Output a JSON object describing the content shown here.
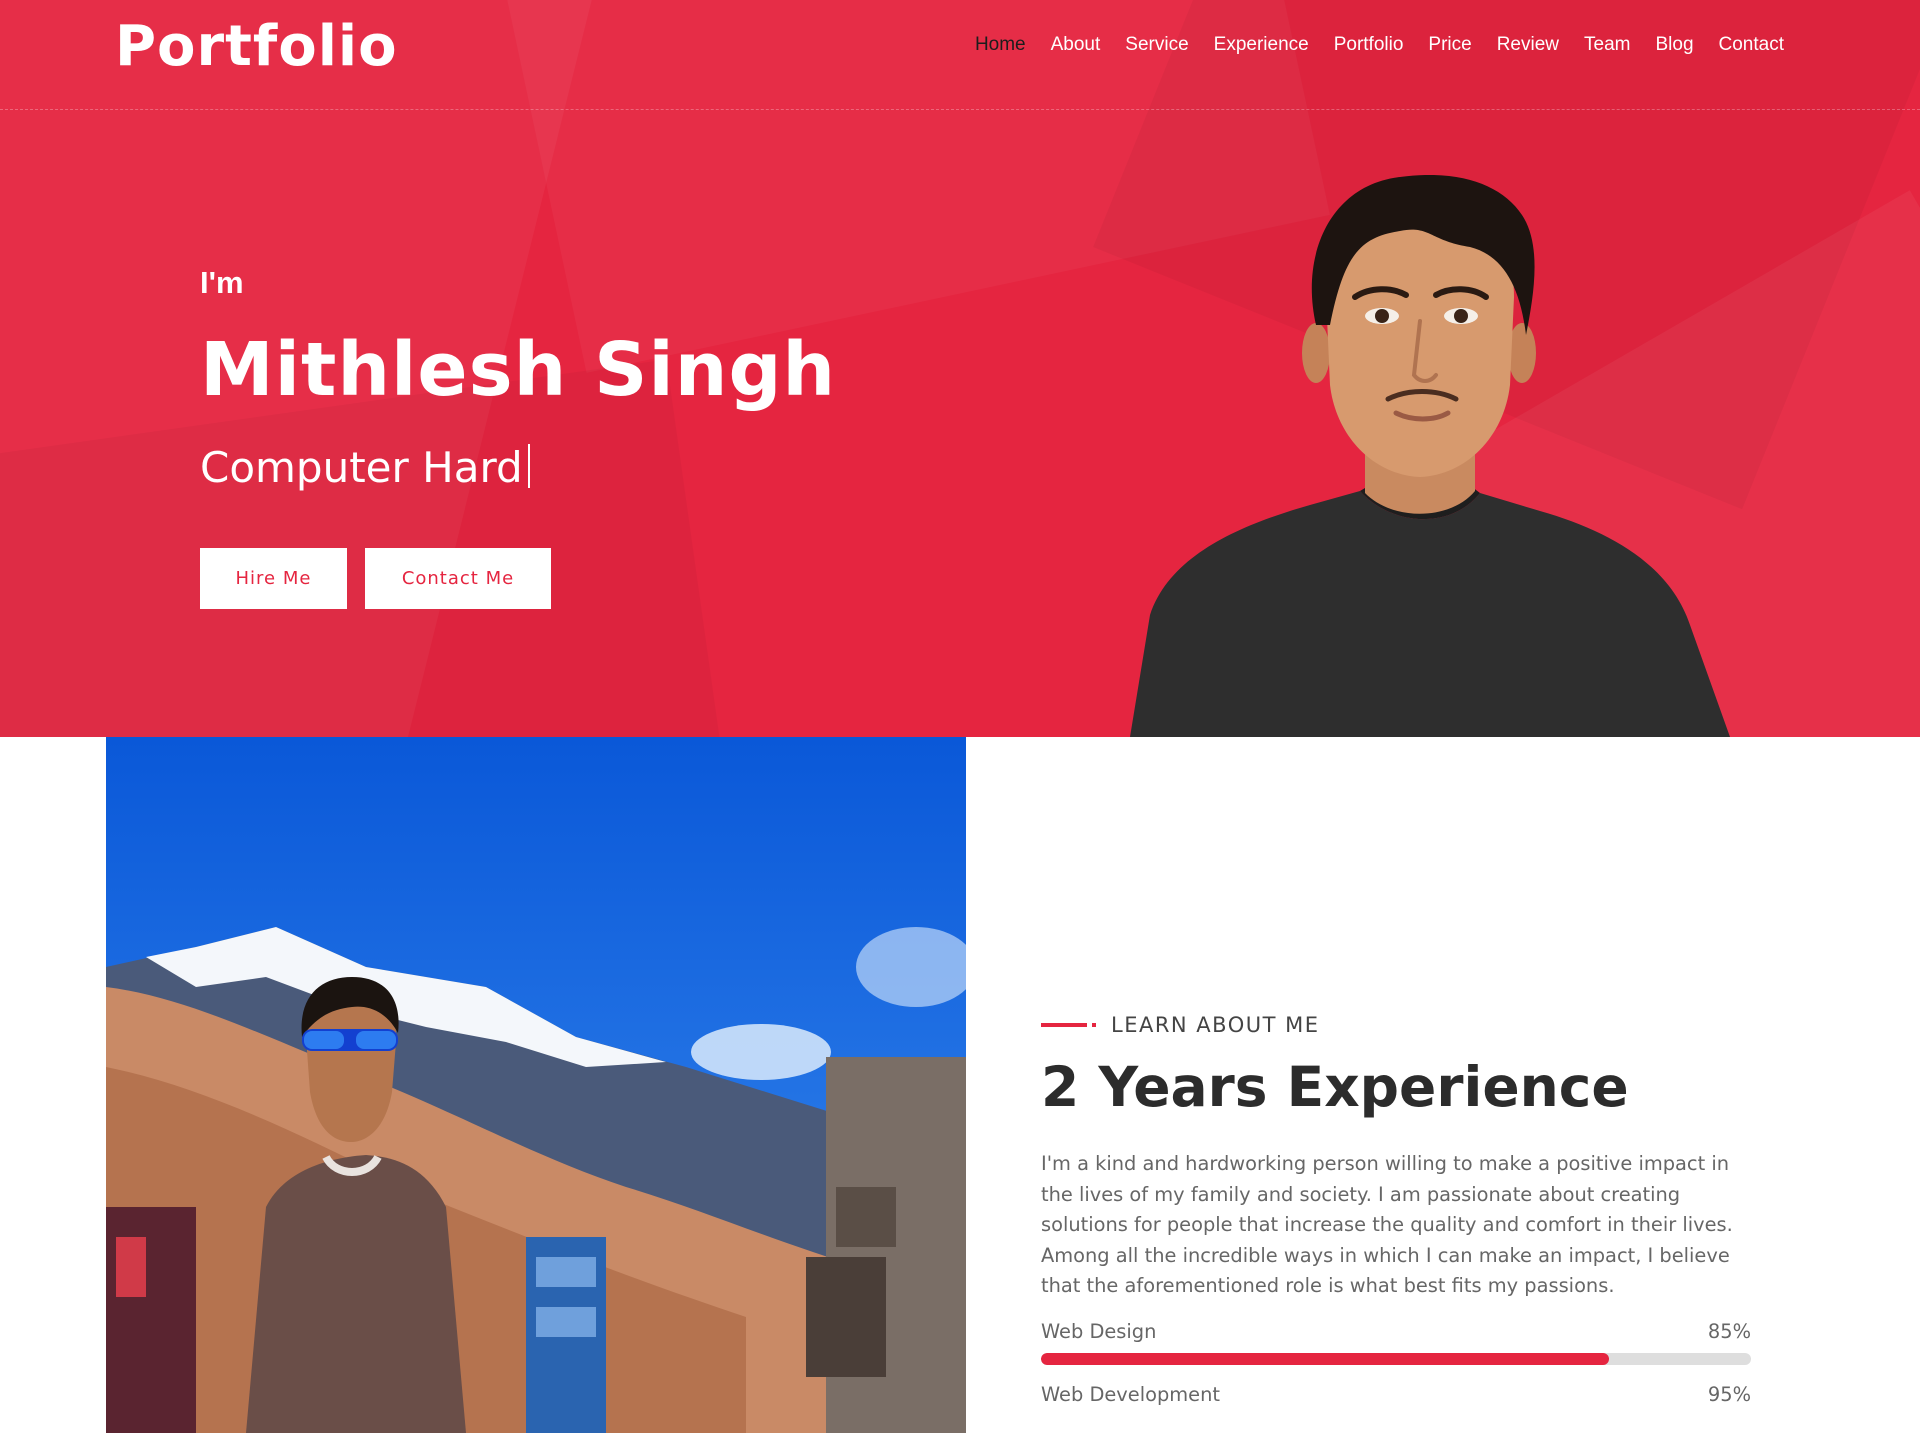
{
  "logo": "Portfolio",
  "nav": [
    {
      "label": "Home",
      "active": true
    },
    {
      "label": "About"
    },
    {
      "label": "Service"
    },
    {
      "label": "Experience"
    },
    {
      "label": "Portfolio"
    },
    {
      "label": "Price"
    },
    {
      "label": "Review"
    },
    {
      "label": "Team"
    },
    {
      "label": "Blog"
    },
    {
      "label": "Contact"
    }
  ],
  "hero": {
    "greeting": "I'm",
    "name": "Mithlesh Singh",
    "role": "Computer Hard",
    "buttons": {
      "hire": "Hire Me",
      "contact": "Contact Me"
    }
  },
  "about": {
    "eyebrow": "LEARN ABOUT ME",
    "title": "2 Years Experience",
    "description": "I'm a kind and hardworking person willing to make a positive impact in the lives of my family and society. I am passionate about creating solutions for people that increase the quality and comfort in their lives. Among all the incredible ways in which I can make an impact, I believe that the aforementioned role is what best fits my passions.",
    "skills": [
      {
        "name": "Web Design",
        "percent_label": "85%",
        "value": 0.8
      },
      {
        "name": "Web Development",
        "percent_label": "95%",
        "value": 0.95
      }
    ]
  },
  "colors": {
    "accent": "#e52540",
    "text_dark": "#2c2c2c",
    "text_muted": "#666666"
  }
}
